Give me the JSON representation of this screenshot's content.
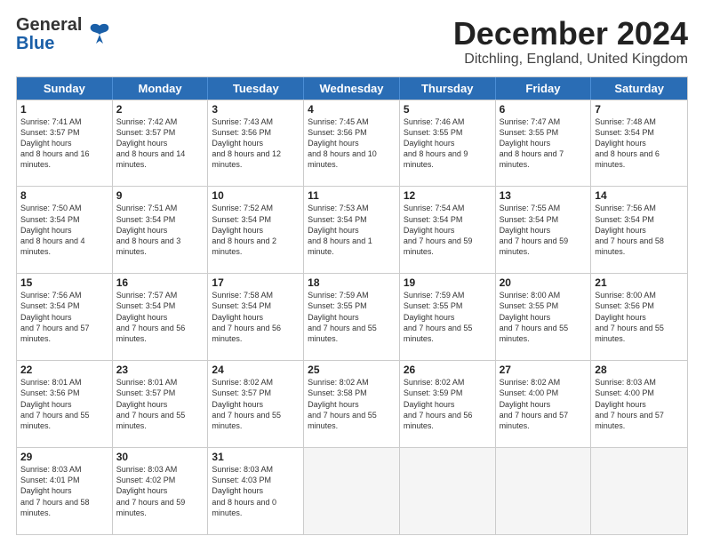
{
  "logo": {
    "line1": "General",
    "line2": "Blue"
  },
  "title": "December 2024",
  "subtitle": "Ditchling, England, United Kingdom",
  "days": [
    "Sunday",
    "Monday",
    "Tuesday",
    "Wednesday",
    "Thursday",
    "Friday",
    "Saturday"
  ],
  "weeks": [
    [
      {
        "day": 1,
        "sr": "7:41 AM",
        "ss": "3:57 PM",
        "dl": "8 hours and 16 minutes."
      },
      {
        "day": 2,
        "sr": "7:42 AM",
        "ss": "3:57 PM",
        "dl": "8 hours and 14 minutes."
      },
      {
        "day": 3,
        "sr": "7:43 AM",
        "ss": "3:56 PM",
        "dl": "8 hours and 12 minutes."
      },
      {
        "day": 4,
        "sr": "7:45 AM",
        "ss": "3:56 PM",
        "dl": "8 hours and 10 minutes."
      },
      {
        "day": 5,
        "sr": "7:46 AM",
        "ss": "3:55 PM",
        "dl": "8 hours and 9 minutes."
      },
      {
        "day": 6,
        "sr": "7:47 AM",
        "ss": "3:55 PM",
        "dl": "8 hours and 7 minutes."
      },
      {
        "day": 7,
        "sr": "7:48 AM",
        "ss": "3:54 PM",
        "dl": "8 hours and 6 minutes."
      }
    ],
    [
      {
        "day": 8,
        "sr": "7:50 AM",
        "ss": "3:54 PM",
        "dl": "8 hours and 4 minutes."
      },
      {
        "day": 9,
        "sr": "7:51 AM",
        "ss": "3:54 PM",
        "dl": "8 hours and 3 minutes."
      },
      {
        "day": 10,
        "sr": "7:52 AM",
        "ss": "3:54 PM",
        "dl": "8 hours and 2 minutes."
      },
      {
        "day": 11,
        "sr": "7:53 AM",
        "ss": "3:54 PM",
        "dl": "8 hours and 1 minute."
      },
      {
        "day": 12,
        "sr": "7:54 AM",
        "ss": "3:54 PM",
        "dl": "7 hours and 59 minutes."
      },
      {
        "day": 13,
        "sr": "7:55 AM",
        "ss": "3:54 PM",
        "dl": "7 hours and 59 minutes."
      },
      {
        "day": 14,
        "sr": "7:56 AM",
        "ss": "3:54 PM",
        "dl": "7 hours and 58 minutes."
      }
    ],
    [
      {
        "day": 15,
        "sr": "7:56 AM",
        "ss": "3:54 PM",
        "dl": "7 hours and 57 minutes."
      },
      {
        "day": 16,
        "sr": "7:57 AM",
        "ss": "3:54 PM",
        "dl": "7 hours and 56 minutes."
      },
      {
        "day": 17,
        "sr": "7:58 AM",
        "ss": "3:54 PM",
        "dl": "7 hours and 56 minutes."
      },
      {
        "day": 18,
        "sr": "7:59 AM",
        "ss": "3:55 PM",
        "dl": "7 hours and 55 minutes."
      },
      {
        "day": 19,
        "sr": "7:59 AM",
        "ss": "3:55 PM",
        "dl": "7 hours and 55 minutes."
      },
      {
        "day": 20,
        "sr": "8:00 AM",
        "ss": "3:55 PM",
        "dl": "7 hours and 55 minutes."
      },
      {
        "day": 21,
        "sr": "8:00 AM",
        "ss": "3:56 PM",
        "dl": "7 hours and 55 minutes."
      }
    ],
    [
      {
        "day": 22,
        "sr": "8:01 AM",
        "ss": "3:56 PM",
        "dl": "7 hours and 55 minutes."
      },
      {
        "day": 23,
        "sr": "8:01 AM",
        "ss": "3:57 PM",
        "dl": "7 hours and 55 minutes."
      },
      {
        "day": 24,
        "sr": "8:02 AM",
        "ss": "3:57 PM",
        "dl": "7 hours and 55 minutes."
      },
      {
        "day": 25,
        "sr": "8:02 AM",
        "ss": "3:58 PM",
        "dl": "7 hours and 55 minutes."
      },
      {
        "day": 26,
        "sr": "8:02 AM",
        "ss": "3:59 PM",
        "dl": "7 hours and 56 minutes."
      },
      {
        "day": 27,
        "sr": "8:02 AM",
        "ss": "4:00 PM",
        "dl": "7 hours and 57 minutes."
      },
      {
        "day": 28,
        "sr": "8:03 AM",
        "ss": "4:00 PM",
        "dl": "7 hours and 57 minutes."
      }
    ],
    [
      {
        "day": 29,
        "sr": "8:03 AM",
        "ss": "4:01 PM",
        "dl": "7 hours and 58 minutes."
      },
      {
        "day": 30,
        "sr": "8:03 AM",
        "ss": "4:02 PM",
        "dl": "7 hours and 59 minutes."
      },
      {
        "day": 31,
        "sr": "8:03 AM",
        "ss": "4:03 PM",
        "dl": "8 hours and 0 minutes."
      },
      null,
      null,
      null,
      null
    ]
  ]
}
